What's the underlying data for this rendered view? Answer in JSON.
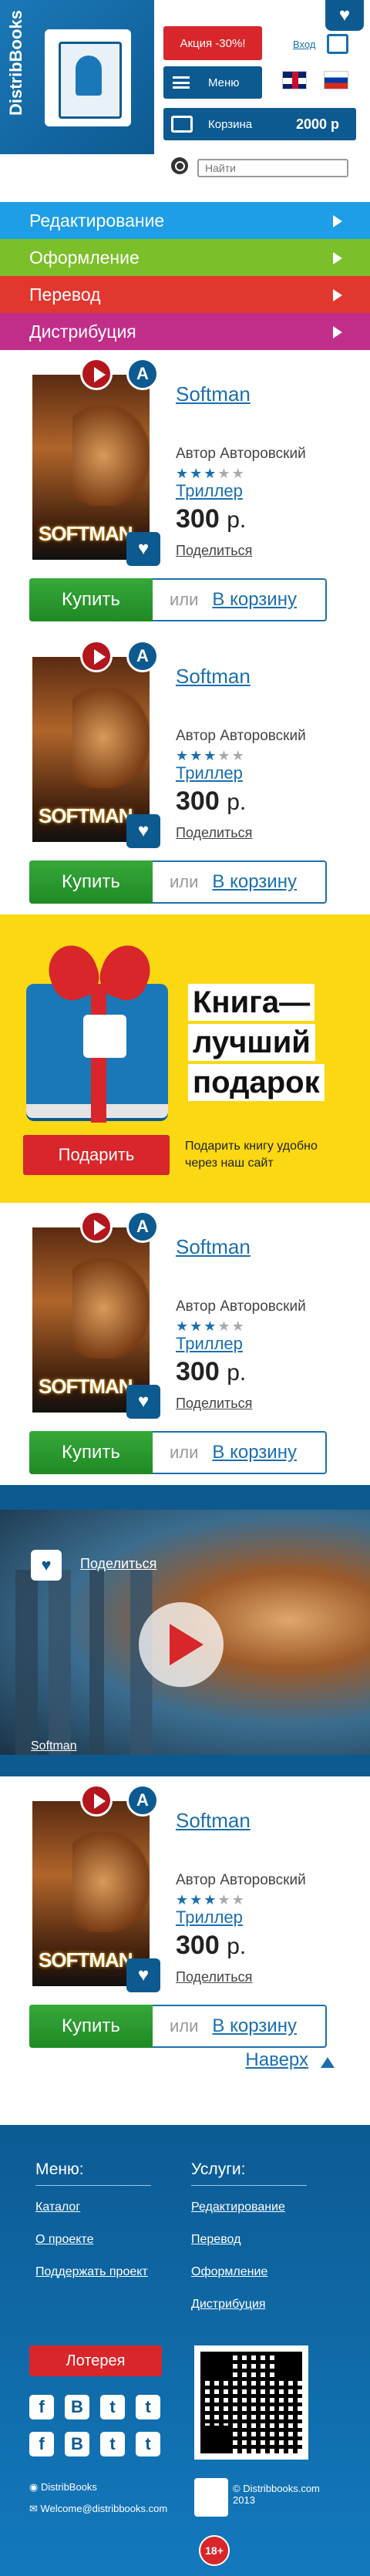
{
  "header": {
    "logo_text": "DistribBooks",
    "sale_label": "Акция -30%!",
    "login_label": "Вход",
    "menu_label": "Меню",
    "cart_label": "Корзина",
    "cart_sum": "2000 р",
    "search_placeholder": "Найти"
  },
  "nav": [
    {
      "label": "Редактирование",
      "color": "#1e9ee6"
    },
    {
      "label": "Оформление",
      "color": "#7bbf2a"
    },
    {
      "label": "Перевод",
      "color": "#e2372f"
    },
    {
      "label": "Дистрибуция",
      "color": "#c12e8a"
    }
  ],
  "product": {
    "title": "Softman",
    "cover_title": "SOFTMAN",
    "author": "Автор Авторовский",
    "rating": 3,
    "rating_max": 5,
    "genre": "Триллер",
    "price": "300",
    "currency": "р.",
    "share_label": "Поделиться",
    "buy_label": "Купить",
    "or_label": "или",
    "cart_label": "В корзину",
    "audio_badge": "A"
  },
  "gift": {
    "heading_line1": "Книга—",
    "heading_line2": "лучший",
    "heading_line3": "подарок",
    "button_label": "Подарить",
    "subtitle": "Подарить книгу удобно через наш сайт"
  },
  "video": {
    "share_label": "Поделиться",
    "title": "Softman"
  },
  "up_label": "Наверх",
  "footer": {
    "menu_heading": "Меню:",
    "menu_links": [
      "Каталог",
      "О проекте",
      "Поддержать проект"
    ],
    "services_heading": "Услуги:",
    "services_links": [
      "Редактирование",
      "Перевод",
      "Оформление",
      "Дистрибуция"
    ],
    "lottery_label": "Лотерея",
    "social": [
      "f",
      "B",
      "t",
      "t",
      "f",
      "B",
      "t",
      "t"
    ],
    "skype": "DistribBooks",
    "email": "Welcome@distribbooks.com",
    "copyright": "© Distribbooks.com 2013",
    "age": "18+"
  },
  "colors": {
    "brand_blue": "#0d5a91",
    "accent_red": "#d8262a",
    "buy_green": "#2a9a2e",
    "banner_yellow": "#fbd812"
  }
}
